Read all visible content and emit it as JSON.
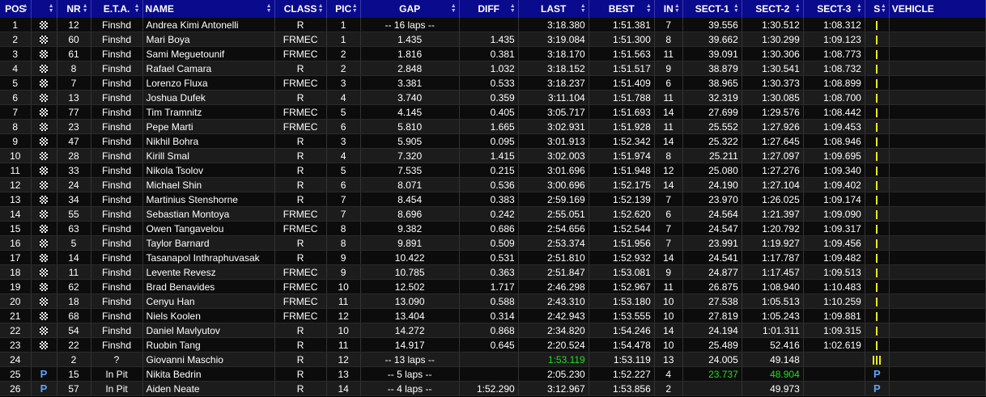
{
  "columns": [
    {
      "key": "pos",
      "label": "POS"
    },
    {
      "key": "flag",
      "label": ""
    },
    {
      "key": "nr",
      "label": "NR"
    },
    {
      "key": "eta",
      "label": "E.T.A."
    },
    {
      "key": "name",
      "label": "NAME"
    },
    {
      "key": "class",
      "label": "CLASS"
    },
    {
      "key": "pic",
      "label": "PIC"
    },
    {
      "key": "gap",
      "label": "GAP"
    },
    {
      "key": "diff",
      "label": "DIFF"
    },
    {
      "key": "last",
      "label": "LAST"
    },
    {
      "key": "best",
      "label": "BEST"
    },
    {
      "key": "in",
      "label": "IN"
    },
    {
      "key": "s1",
      "label": "SECT-1"
    },
    {
      "key": "s2",
      "label": "SECT-2"
    },
    {
      "key": "s3",
      "label": "SECT-3"
    },
    {
      "key": "s",
      "label": "S"
    },
    {
      "key": "vehicle",
      "label": "VEHICLE"
    }
  ],
  "colors": {
    "header_bg": "#0a0a8c",
    "sector_bar": "#e8e820",
    "best_green": "#22dd22",
    "pit_blue": "#5aa6ff"
  },
  "rows": [
    {
      "pos": "1",
      "flag": "checkered",
      "nr": "12",
      "eta": "Finshd",
      "name": "Andrea Kimi Antonelli",
      "class": "R",
      "pic": "1",
      "gap": "-- 16 laps --",
      "diff": "",
      "last": "3:18.380",
      "best": "1:51.381",
      "in": "7",
      "s1": "39.556",
      "s2": "1:30.512",
      "s3": "1:08.312",
      "s": "1",
      "vehicle": ""
    },
    {
      "pos": "2",
      "flag": "checkered",
      "nr": "60",
      "eta": "Finshd",
      "name": "Mari Boya",
      "class": "FRMEC",
      "pic": "1",
      "gap": "1.435",
      "diff": "1.435",
      "last": "3:19.084",
      "best": "1:51.300",
      "in": "8",
      "s1": "39.662",
      "s2": "1:30.299",
      "s3": "1:09.123",
      "s": "1",
      "vehicle": ""
    },
    {
      "pos": "3",
      "flag": "checkered",
      "nr": "61",
      "eta": "Finshd",
      "name": "Sami Meguetounif",
      "class": "FRMEC",
      "pic": "2",
      "gap": "1.816",
      "diff": "0.381",
      "last": "3:18.170",
      "best": "1:51.563",
      "in": "11",
      "s1": "39.091",
      "s2": "1:30.306",
      "s3": "1:08.773",
      "s": "1",
      "vehicle": ""
    },
    {
      "pos": "4",
      "flag": "checkered",
      "nr": "8",
      "eta": "Finshd",
      "name": "Rafael Camara",
      "class": "R",
      "pic": "2",
      "gap": "2.848",
      "diff": "1.032",
      "last": "3:18.152",
      "best": "1:51.517",
      "in": "9",
      "s1": "38.879",
      "s2": "1:30.541",
      "s3": "1:08.732",
      "s": "1",
      "vehicle": ""
    },
    {
      "pos": "5",
      "flag": "checkered",
      "nr": "7",
      "eta": "Finshd",
      "name": "Lorenzo Fluxa",
      "class": "FRMEC",
      "pic": "3",
      "gap": "3.381",
      "diff": "0.533",
      "last": "3:18.237",
      "best": "1:51.409",
      "in": "6",
      "s1": "38.965",
      "s2": "1:30.373",
      "s3": "1:08.899",
      "s": "1",
      "vehicle": ""
    },
    {
      "pos": "6",
      "flag": "checkered",
      "nr": "13",
      "eta": "Finshd",
      "name": "Joshua Dufek",
      "class": "R",
      "pic": "4",
      "gap": "3.740",
      "diff": "0.359",
      "last": "3:11.104",
      "best": "1:51.788",
      "in": "11",
      "s1": "32.319",
      "s2": "1:30.085",
      "s3": "1:08.700",
      "s": "1",
      "vehicle": ""
    },
    {
      "pos": "7",
      "flag": "checkered",
      "nr": "77",
      "eta": "Finshd",
      "name": "Tim Tramnitz",
      "class": "FRMEC",
      "pic": "5",
      "gap": "4.145",
      "diff": "0.405",
      "last": "3:05.717",
      "best": "1:51.693",
      "in": "14",
      "s1": "27.699",
      "s2": "1:29.576",
      "s3": "1:08.442",
      "s": "1",
      "vehicle": ""
    },
    {
      "pos": "8",
      "flag": "checkered",
      "nr": "23",
      "eta": "Finshd",
      "name": "Pepe Marti",
      "class": "FRMEC",
      "pic": "6",
      "gap": "5.810",
      "diff": "1.665",
      "last": "3:02.931",
      "best": "1:51.928",
      "in": "11",
      "s1": "25.552",
      "s2": "1:27.926",
      "s3": "1:09.453",
      "s": "1",
      "vehicle": ""
    },
    {
      "pos": "9",
      "flag": "checkered",
      "nr": "47",
      "eta": "Finshd",
      "name": "Nikhil Bohra",
      "class": "R",
      "pic": "3",
      "gap": "5.905",
      "diff": "0.095",
      "last": "3:01.913",
      "best": "1:52.342",
      "in": "14",
      "s1": "25.322",
      "s2": "1:27.645",
      "s3": "1:08.946",
      "s": "1",
      "vehicle": ""
    },
    {
      "pos": "10",
      "flag": "checkered",
      "nr": "28",
      "eta": "Finshd",
      "name": "Kirill Smal",
      "class": "R",
      "pic": "4",
      "gap": "7.320",
      "diff": "1.415",
      "last": "3:02.003",
      "best": "1:51.974",
      "in": "8",
      "s1": "25.211",
      "s2": "1:27.097",
      "s3": "1:09.695",
      "s": "1",
      "vehicle": ""
    },
    {
      "pos": "11",
      "flag": "checkered",
      "nr": "33",
      "eta": "Finshd",
      "name": "Nikola Tsolov",
      "class": "R",
      "pic": "5",
      "gap": "7.535",
      "diff": "0.215",
      "last": "3:01.696",
      "best": "1:51.948",
      "in": "12",
      "s1": "25.080",
      "s2": "1:27.276",
      "s3": "1:09.340",
      "s": "1",
      "vehicle": ""
    },
    {
      "pos": "12",
      "flag": "checkered",
      "nr": "24",
      "eta": "Finshd",
      "name": "Michael Shin",
      "class": "R",
      "pic": "6",
      "gap": "8.071",
      "diff": "0.536",
      "last": "3:00.696",
      "best": "1:52.175",
      "in": "14",
      "s1": "24.190",
      "s2": "1:27.104",
      "s3": "1:09.402",
      "s": "1",
      "vehicle": ""
    },
    {
      "pos": "13",
      "flag": "checkered",
      "nr": "34",
      "eta": "Finshd",
      "name": "Martinius Stenshorne",
      "class": "R",
      "pic": "7",
      "gap": "8.454",
      "diff": "0.383",
      "last": "2:59.169",
      "best": "1:52.139",
      "in": "7",
      "s1": "23.970",
      "s2": "1:26.025",
      "s3": "1:09.174",
      "s": "1",
      "vehicle": ""
    },
    {
      "pos": "14",
      "flag": "checkered",
      "nr": "55",
      "eta": "Finshd",
      "name": "Sebastian Montoya",
      "class": "FRMEC",
      "pic": "7",
      "gap": "8.696",
      "diff": "0.242",
      "last": "2:55.051",
      "best": "1:52.620",
      "in": "6",
      "s1": "24.564",
      "s2": "1:21.397",
      "s3": "1:09.090",
      "s": "1",
      "vehicle": ""
    },
    {
      "pos": "15",
      "flag": "checkered",
      "nr": "63",
      "eta": "Finshd",
      "name": "Owen Tangavelou",
      "class": "FRMEC",
      "pic": "8",
      "gap": "9.382",
      "diff": "0.686",
      "last": "2:54.656",
      "best": "1:52.544",
      "in": "7",
      "s1": "24.547",
      "s2": "1:20.792",
      "s3": "1:09.317",
      "s": "1",
      "vehicle": ""
    },
    {
      "pos": "16",
      "flag": "checkered",
      "nr": "5",
      "eta": "Finshd",
      "name": "Taylor Barnard",
      "class": "R",
      "pic": "8",
      "gap": "9.891",
      "diff": "0.509",
      "last": "2:53.374",
      "best": "1:51.956",
      "in": "7",
      "s1": "23.991",
      "s2": "1:19.927",
      "s3": "1:09.456",
      "s": "1",
      "vehicle": ""
    },
    {
      "pos": "17",
      "flag": "checkered",
      "nr": "14",
      "eta": "Finshd",
      "name": "Tasanapol Inthraphuvasak",
      "class": "R",
      "pic": "9",
      "gap": "10.422",
      "diff": "0.531",
      "last": "2:51.810",
      "best": "1:52.932",
      "in": "14",
      "s1": "24.541",
      "s2": "1:17.787",
      "s3": "1:09.482",
      "s": "1",
      "vehicle": ""
    },
    {
      "pos": "18",
      "flag": "checkered",
      "nr": "11",
      "eta": "Finshd",
      "name": "Levente Revesz",
      "class": "FRMEC",
      "pic": "9",
      "gap": "10.785",
      "diff": "0.363",
      "last": "2:51.847",
      "best": "1:53.081",
      "in": "9",
      "s1": "24.877",
      "s2": "1:17.457",
      "s3": "1:09.513",
      "s": "1",
      "vehicle": ""
    },
    {
      "pos": "19",
      "flag": "checkered",
      "nr": "62",
      "eta": "Finshd",
      "name": "Brad Benavides",
      "class": "FRMEC",
      "pic": "10",
      "gap": "12.502",
      "diff": "1.717",
      "last": "2:46.298",
      "best": "1:52.967",
      "in": "11",
      "s1": "26.875",
      "s2": "1:08.940",
      "s3": "1:10.483",
      "s": "1",
      "vehicle": ""
    },
    {
      "pos": "20",
      "flag": "checkered",
      "nr": "18",
      "eta": "Finshd",
      "name": "Cenyu Han",
      "class": "FRMEC",
      "pic": "11",
      "gap": "13.090",
      "diff": "0.588",
      "last": "2:43.310",
      "best": "1:53.180",
      "in": "10",
      "s1": "27.538",
      "s2": "1:05.513",
      "s3": "1:10.259",
      "s": "1",
      "vehicle": ""
    },
    {
      "pos": "21",
      "flag": "checkered",
      "nr": "68",
      "eta": "Finshd",
      "name": "Niels Koolen",
      "class": "FRMEC",
      "pic": "12",
      "gap": "13.404",
      "diff": "0.314",
      "last": "2:42.943",
      "best": "1:53.555",
      "in": "10",
      "s1": "27.819",
      "s2": "1:05.243",
      "s3": "1:09.881",
      "s": "1",
      "vehicle": ""
    },
    {
      "pos": "22",
      "flag": "checkered",
      "nr": "54",
      "eta": "Finshd",
      "name": "Daniel Mavlyutov",
      "class": "R",
      "pic": "10",
      "gap": "14.272",
      "diff": "0.868",
      "last": "2:34.820",
      "best": "1:54.246",
      "in": "14",
      "s1": "24.194",
      "s2": "1:01.311",
      "s3": "1:09.315",
      "s": "1",
      "vehicle": ""
    },
    {
      "pos": "23",
      "flag": "checkered",
      "nr": "22",
      "eta": "Finshd",
      "name": "Ruobin Tang",
      "class": "R",
      "pic": "11",
      "gap": "14.917",
      "diff": "0.645",
      "last": "2:20.524",
      "best": "1:54.478",
      "in": "10",
      "s1": "25.489",
      "s2": "52.416",
      "s3": "1:02.619",
      "s": "1",
      "vehicle": ""
    },
    {
      "pos": "24",
      "flag": "",
      "nr": "2",
      "eta": "?",
      "name": "Giovanni Maschio",
      "class": "R",
      "pic": "12",
      "gap": "-- 13 laps --",
      "diff": "",
      "last": "1:53.119",
      "last_green": true,
      "best": "1:53.119",
      "in": "13",
      "s1": "24.005",
      "s2": "49.148",
      "s3": "",
      "s": "3",
      "vehicle": ""
    },
    {
      "pos": "25",
      "flag": "P",
      "nr": "15",
      "eta": "In Pit",
      "name": "Nikita Bedrin",
      "class": "R",
      "pic": "13",
      "gap": "-- 5 laps --",
      "diff": "",
      "last": "2:05.230",
      "best": "1:52.227",
      "in": "4",
      "s1": "23.737",
      "s1_green": true,
      "s2": "48.904",
      "s2_green": true,
      "s3": "",
      "s": "P",
      "vehicle": ""
    },
    {
      "pos": "26",
      "flag": "P",
      "nr": "57",
      "eta": "In Pit",
      "name": "Aiden Neate",
      "class": "R",
      "pic": "14",
      "gap": "-- 4 laps --",
      "diff": "1:52.290",
      "last": "3:12.967",
      "best": "1:53.856",
      "in": "2",
      "s1": "",
      "s2": "49.973",
      "s3": "",
      "s": "P",
      "vehicle": ""
    }
  ]
}
